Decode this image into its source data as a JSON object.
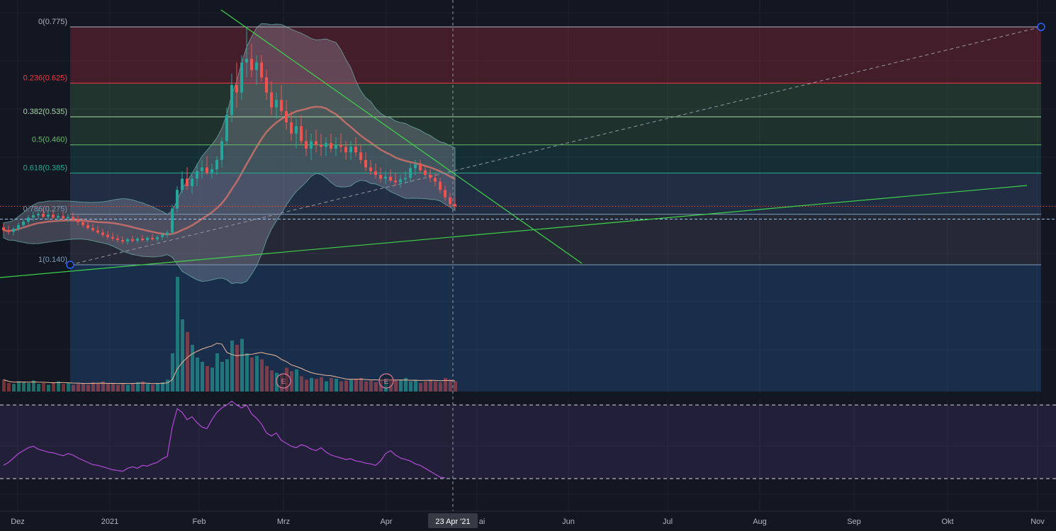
{
  "chart_data": {
    "type": "candlestick",
    "fib_levels": [
      {
        "label": "0(0.775)",
        "ratio": 0,
        "price": 0.775,
        "color": "#b2b5be"
      },
      {
        "label": "0.236(0.625)",
        "ratio": 0.236,
        "price": 0.625,
        "color": "#f23645"
      },
      {
        "label": "0.382(0.535)",
        "ratio": 0.382,
        "price": 0.535,
        "color": "#a5d6a7"
      },
      {
        "label": "0.5(0.460)",
        "ratio": 0.5,
        "price": 0.46,
        "color": "#66bb6a"
      },
      {
        "label": "0.618(0.385)",
        "ratio": 0.618,
        "price": 0.385,
        "color": "#22ab94"
      },
      {
        "label": "0.786(0.275)",
        "ratio": 0.786,
        "price": 0.275,
        "color": "#7e9ab8"
      },
      {
        "label": "1(0.140)",
        "ratio": 1,
        "price": 0.14,
        "color": "#7e9ab8"
      }
    ],
    "x_tick_labels": [
      "Dez",
      "2021",
      "Feb",
      "Mrz",
      "Apr",
      "ai",
      "Jun",
      "Jul",
      "Aug",
      "Sep",
      "Okt",
      "Nov"
    ],
    "cursor_label": "23 Apr '21",
    "earnings_markers": [
      "E",
      "E"
    ],
    "candles": [
      [
        0.24,
        0.25,
        0.225,
        0.232
      ],
      [
        0.232,
        0.245,
        0.22,
        0.228
      ],
      [
        0.228,
        0.24,
        0.218,
        0.236
      ],
      [
        0.236,
        0.252,
        0.23,
        0.246
      ],
      [
        0.246,
        0.262,
        0.238,
        0.255
      ],
      [
        0.255,
        0.272,
        0.248,
        0.266
      ],
      [
        0.266,
        0.282,
        0.256,
        0.272
      ],
      [
        0.272,
        0.286,
        0.262,
        0.276
      ],
      [
        0.276,
        0.29,
        0.264,
        0.268
      ],
      [
        0.268,
        0.284,
        0.26,
        0.274
      ],
      [
        0.274,
        0.285,
        0.262,
        0.266
      ],
      [
        0.266,
        0.278,
        0.256,
        0.27
      ],
      [
        0.27,
        0.282,
        0.26,
        0.264
      ],
      [
        0.264,
        0.276,
        0.254,
        0.268
      ],
      [
        0.268,
        0.28,
        0.258,
        0.262
      ],
      [
        0.262,
        0.272,
        0.246,
        0.254
      ],
      [
        0.254,
        0.264,
        0.24,
        0.246
      ],
      [
        0.246,
        0.256,
        0.234,
        0.238
      ],
      [
        0.238,
        0.25,
        0.228,
        0.232
      ],
      [
        0.232,
        0.244,
        0.222,
        0.226
      ],
      [
        0.226,
        0.236,
        0.214,
        0.22
      ],
      [
        0.22,
        0.23,
        0.208,
        0.214
      ],
      [
        0.214,
        0.226,
        0.204,
        0.21
      ],
      [
        0.21,
        0.22,
        0.2,
        0.206
      ],
      [
        0.206,
        0.216,
        0.196,
        0.202
      ],
      [
        0.202,
        0.212,
        0.194,
        0.208
      ],
      [
        0.208,
        0.218,
        0.2,
        0.204
      ],
      [
        0.204,
        0.214,
        0.198,
        0.21
      ],
      [
        0.21,
        0.22,
        0.202,
        0.206
      ],
      [
        0.206,
        0.216,
        0.2,
        0.212
      ],
      [
        0.212,
        0.222,
        0.204,
        0.208
      ],
      [
        0.208,
        0.218,
        0.202,
        0.214
      ],
      [
        0.214,
        0.226,
        0.206,
        0.22
      ],
      [
        0.22,
        0.232,
        0.212,
        0.226
      ],
      [
        0.226,
        0.3,
        0.22,
        0.29
      ],
      [
        0.29,
        0.35,
        0.28,
        0.34
      ],
      [
        0.34,
        0.39,
        0.33,
        0.37
      ],
      [
        0.37,
        0.4,
        0.34,
        0.35
      ],
      [
        0.35,
        0.38,
        0.33,
        0.37
      ],
      [
        0.37,
        0.41,
        0.35,
        0.39
      ],
      [
        0.39,
        0.42,
        0.37,
        0.4
      ],
      [
        0.4,
        0.43,
        0.38,
        0.385
      ],
      [
        0.385,
        0.41,
        0.37,
        0.395
      ],
      [
        0.395,
        0.43,
        0.38,
        0.42
      ],
      [
        0.42,
        0.48,
        0.4,
        0.47
      ],
      [
        0.47,
        0.56,
        0.46,
        0.54
      ],
      [
        0.54,
        0.65,
        0.52,
        0.62
      ],
      [
        0.62,
        0.68,
        0.56,
        0.6
      ],
      [
        0.6,
        0.7,
        0.58,
        0.68
      ],
      [
        0.68,
        0.775,
        0.64,
        0.69
      ],
      [
        0.69,
        0.73,
        0.64,
        0.66
      ],
      [
        0.66,
        0.7,
        0.62,
        0.68
      ],
      [
        0.68,
        0.7,
        0.63,
        0.64
      ],
      [
        0.64,
        0.66,
        0.58,
        0.6
      ],
      [
        0.6,
        0.63,
        0.54,
        0.56
      ],
      [
        0.56,
        0.6,
        0.53,
        0.58
      ],
      [
        0.58,
        0.62,
        0.54,
        0.55
      ],
      [
        0.55,
        0.58,
        0.5,
        0.52
      ],
      [
        0.52,
        0.55,
        0.47,
        0.49
      ],
      [
        0.49,
        0.53,
        0.45,
        0.51
      ],
      [
        0.51,
        0.54,
        0.46,
        0.47
      ],
      [
        0.47,
        0.5,
        0.43,
        0.45
      ],
      [
        0.45,
        0.49,
        0.42,
        0.47
      ],
      [
        0.47,
        0.5,
        0.44,
        0.46
      ],
      [
        0.46,
        0.49,
        0.43,
        0.455
      ],
      [
        0.455,
        0.48,
        0.43,
        0.465
      ],
      [
        0.465,
        0.49,
        0.44,
        0.45
      ],
      [
        0.45,
        0.48,
        0.43,
        0.46
      ],
      [
        0.46,
        0.49,
        0.44,
        0.455
      ],
      [
        0.455,
        0.47,
        0.42,
        0.44
      ],
      [
        0.44,
        0.47,
        0.42,
        0.455
      ],
      [
        0.455,
        0.48,
        0.43,
        0.44
      ],
      [
        0.44,
        0.46,
        0.41,
        0.42
      ],
      [
        0.42,
        0.44,
        0.39,
        0.4
      ],
      [
        0.4,
        0.42,
        0.38,
        0.39
      ],
      [
        0.39,
        0.41,
        0.37,
        0.38
      ],
      [
        0.38,
        0.4,
        0.36,
        0.37
      ],
      [
        0.37,
        0.39,
        0.355,
        0.375
      ],
      [
        0.375,
        0.395,
        0.36,
        0.365
      ],
      [
        0.365,
        0.385,
        0.35,
        0.36
      ],
      [
        0.36,
        0.38,
        0.345,
        0.368
      ],
      [
        0.368,
        0.39,
        0.355,
        0.372
      ],
      [
        0.372,
        0.41,
        0.36,
        0.398
      ],
      [
        0.398,
        0.42,
        0.38,
        0.408
      ],
      [
        0.408,
        0.42,
        0.385,
        0.392
      ],
      [
        0.392,
        0.405,
        0.375,
        0.38
      ],
      [
        0.38,
        0.395,
        0.36,
        0.372
      ],
      [
        0.372,
        0.385,
        0.35,
        0.362
      ],
      [
        0.362,
        0.372,
        0.33,
        0.34
      ],
      [
        0.34,
        0.352,
        0.31,
        0.32
      ],
      [
        0.32,
        0.332,
        0.295,
        0.302
      ],
      [
        0.302,
        0.32,
        0.29,
        0.296
      ]
    ],
    "volume": [
      14,
      10,
      9,
      12,
      11,
      10,
      13,
      9,
      10,
      8,
      11,
      12,
      9,
      10,
      8,
      9,
      10,
      8,
      11,
      10,
      12,
      9,
      10,
      8,
      9,
      8,
      10,
      11,
      12,
      9,
      8,
      10,
      11,
      14,
      45,
      135,
      85,
      70,
      55,
      40,
      35,
      30,
      28,
      45,
      35,
      38,
      60,
      55,
      62,
      45,
      40,
      42,
      38,
      30,
      25,
      22,
      20,
      28,
      24,
      26,
      18,
      14,
      16,
      15,
      17,
      12,
      16,
      15,
      12,
      13,
      14,
      15,
      16,
      12,
      13,
      11,
      14,
      12,
      15,
      13,
      14,
      16,
      12,
      13,
      10,
      12,
      14,
      12,
      11,
      16,
      14,
      12
    ],
    "rsi": [
      18,
      22,
      28,
      34,
      38,
      42,
      44,
      40,
      38,
      36,
      35,
      33,
      31,
      34,
      32,
      28,
      25,
      22,
      19,
      18,
      16,
      14,
      12,
      11,
      10,
      14,
      16,
      14,
      18,
      17,
      20,
      22,
      27,
      30,
      70,
      95,
      90,
      80,
      84,
      76,
      70,
      68,
      80,
      90,
      96,
      100,
      105,
      100,
      96,
      100,
      88,
      82,
      74,
      62,
      58,
      62,
      52,
      48,
      44,
      42,
      46,
      44,
      40,
      38,
      42,
      36,
      32,
      30,
      28,
      26,
      27,
      24,
      23,
      21,
      20,
      18,
      24,
      34,
      38,
      32,
      28,
      26,
      24,
      20,
      18,
      14,
      10,
      6,
      2,
      1
    ]
  }
}
